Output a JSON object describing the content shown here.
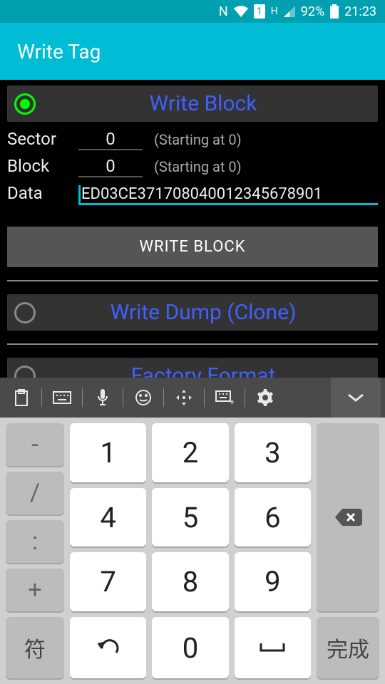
{
  "statusbar": {
    "nfc": "N",
    "sim": "1",
    "net": "H",
    "battery": "92%",
    "time": "21:23"
  },
  "appbar": {
    "title": "Write Tag"
  },
  "sections": {
    "write_block": {
      "title": "Write Block"
    },
    "write_dump": {
      "title": "Write Dump (Clone)"
    },
    "factory": {
      "title": "Factory Format"
    }
  },
  "form": {
    "sector_label": "Sector",
    "sector_value": "0",
    "sector_hint": "(Starting at 0)",
    "block_label": "Block",
    "block_value": "0",
    "block_hint": "(Starting at 0)",
    "data_label": "Data",
    "data_value": "ED03CE371708040012345678901"
  },
  "buttons": {
    "write_block": "WRITE BLOCK"
  },
  "keyboard": {
    "toolbar": [
      "clipboard",
      "keyboard",
      "mic",
      "emoji",
      "move",
      "kbset",
      "gear",
      "collapse"
    ],
    "r1": [
      "-",
      "1",
      "2",
      "3",
      "bksp"
    ],
    "r2": [
      "/",
      "4",
      "5",
      "6"
    ],
    "r3": [
      ":",
      "7",
      "8",
      "9"
    ],
    "r4": [
      "+"
    ],
    "r5": [
      "符",
      "undo",
      "0",
      "space",
      "完成"
    ]
  }
}
